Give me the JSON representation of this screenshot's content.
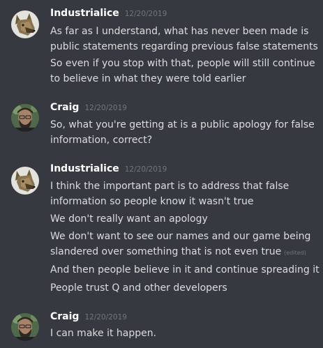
{
  "groups": [
    {
      "username": "Industrialice",
      "timestamp": "12/20/2019",
      "avatar": "wolf-avatar",
      "messages": [
        [
          "As far as I understand, what has never been made is",
          "public statements regarding previous false statements"
        ],
        [
          "So even if you stop with that, people will still continue",
          "to believe in what they were told earlier"
        ]
      ]
    },
    {
      "username": "Craig",
      "timestamp": "12/20/2019",
      "avatar": "bearded-man-avatar",
      "messages": [
        [
          "So, what you're getting at is a public apology for false",
          "information, correct?"
        ]
      ]
    },
    {
      "username": "Industrialice",
      "timestamp": "12/20/2019",
      "avatar": "wolf-avatar",
      "messages": [
        [
          "I think the important part is to address that false",
          "information so people know it wasn't true"
        ],
        [
          "We don't really want an apology"
        ],
        [
          "We don't want to see our names and our game being",
          "slandered over something that is not even true"
        ],
        [
          "And then people believe in it and continue spreading it"
        ],
        [
          "People trust Q and other developers"
        ]
      ],
      "edited_label": "(edited)"
    },
    {
      "username": "Craig",
      "timestamp": "12/20/2019",
      "avatar": "bearded-man-avatar",
      "messages": [
        [
          "I can make it happen."
        ]
      ]
    }
  ],
  "colors": {
    "background": "#36393f",
    "username": "#ffffff",
    "text": "#dcddde",
    "muted": "#72767d"
  }
}
